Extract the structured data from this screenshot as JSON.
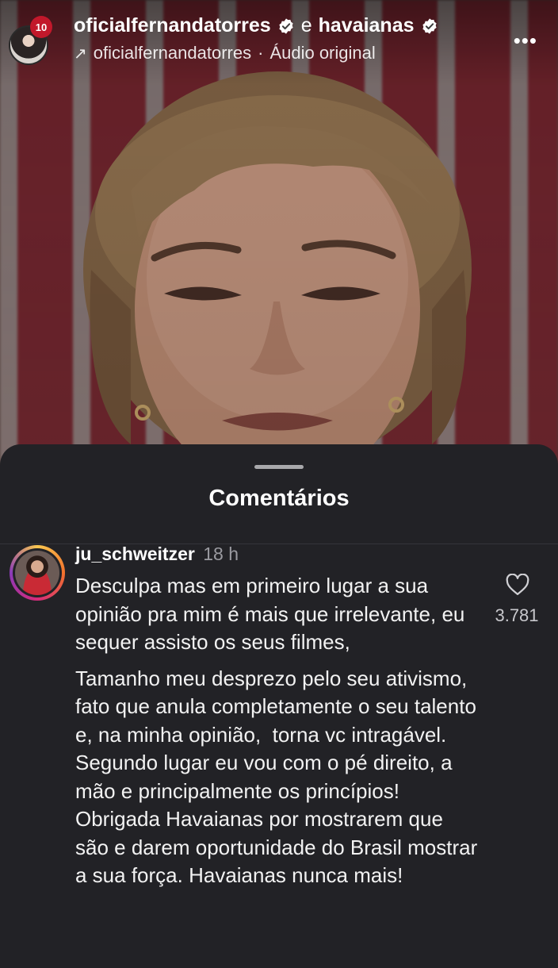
{
  "header": {
    "account_primary": "oficialfernandatorres",
    "conjunction": "e",
    "account_secondary": "havaianas",
    "audio_account": "oficialfernandatorres",
    "audio_separator": "·",
    "audio_label": "Áudio original",
    "badge": "10",
    "icons": {
      "verified": "verified-badge-icon",
      "audio": "arrow-up-right-icon",
      "more": "more-dots-icon"
    }
  },
  "sheet": {
    "title": "Comentários"
  },
  "comment": {
    "username": "ju_schweitzer",
    "time": "18 h",
    "paragraphs": [
      "Desculpa mas em primeiro lugar a sua opinião pra mim é mais que irrelevante, eu sequer assisto os seus filmes,",
      "Tamanho meu desprezo pelo seu ativismo, fato que anula completamente o seu talento e, na minha opinião,  torna vc intragável. Segundo lugar eu vou com o pé direito, a mão e principalmente os princípios! Obrigada Havaianas por mostrarem que são e darem oportunidade do Brasil mostrar a sua força. Havaianas nunca mais!"
    ],
    "likes": "3.781",
    "icons": {
      "like": "heart-outline-icon"
    }
  },
  "colors": {
    "sheet_background": "#222226",
    "text": "#f2f2f2",
    "muted": "#9a9aa0",
    "story_ring": [
      "#f9c74f",
      "#f3722c",
      "#d62b7a",
      "#8a3ab9"
    ]
  }
}
